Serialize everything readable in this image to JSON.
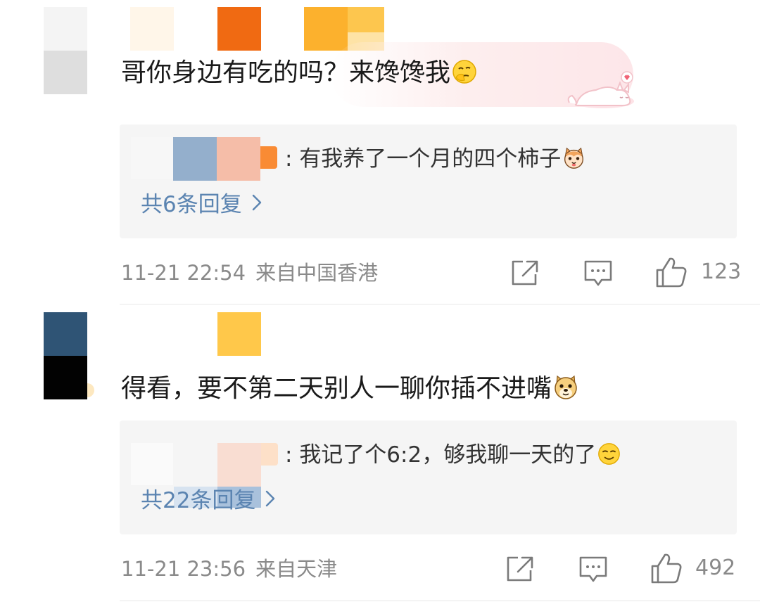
{
  "comments": [
    {
      "text": "哥你身边有吃的吗？来馋馋我",
      "emoji": "thinking-face-emoji",
      "reply_preview": {
        "separator": ":",
        "text": "有我养了一个月的四个柿子",
        "emoji": "cat-face-emoji"
      },
      "reply_count_label": "共6条回复",
      "timestamp": "11-21 22:54",
      "location": "来自中国香港",
      "likes": "123"
    },
    {
      "text": "得看，要不第二天别人一聊你插不进嘴",
      "emoji": "doge-emoji",
      "reply_preview": {
        "separator": ":",
        "text": "我记了个6:2，够我聊一天的了",
        "emoji": "smug-face-emoji"
      },
      "reply_count_label": "共22条回复",
      "timestamp": "11-21 23:56",
      "location": "来自天津",
      "likes": "492"
    }
  ],
  "colors": {
    "link_blue": "#5b84b1",
    "meta_gray": "#8a8a8a",
    "reply_bg": "#f5f5f5"
  }
}
